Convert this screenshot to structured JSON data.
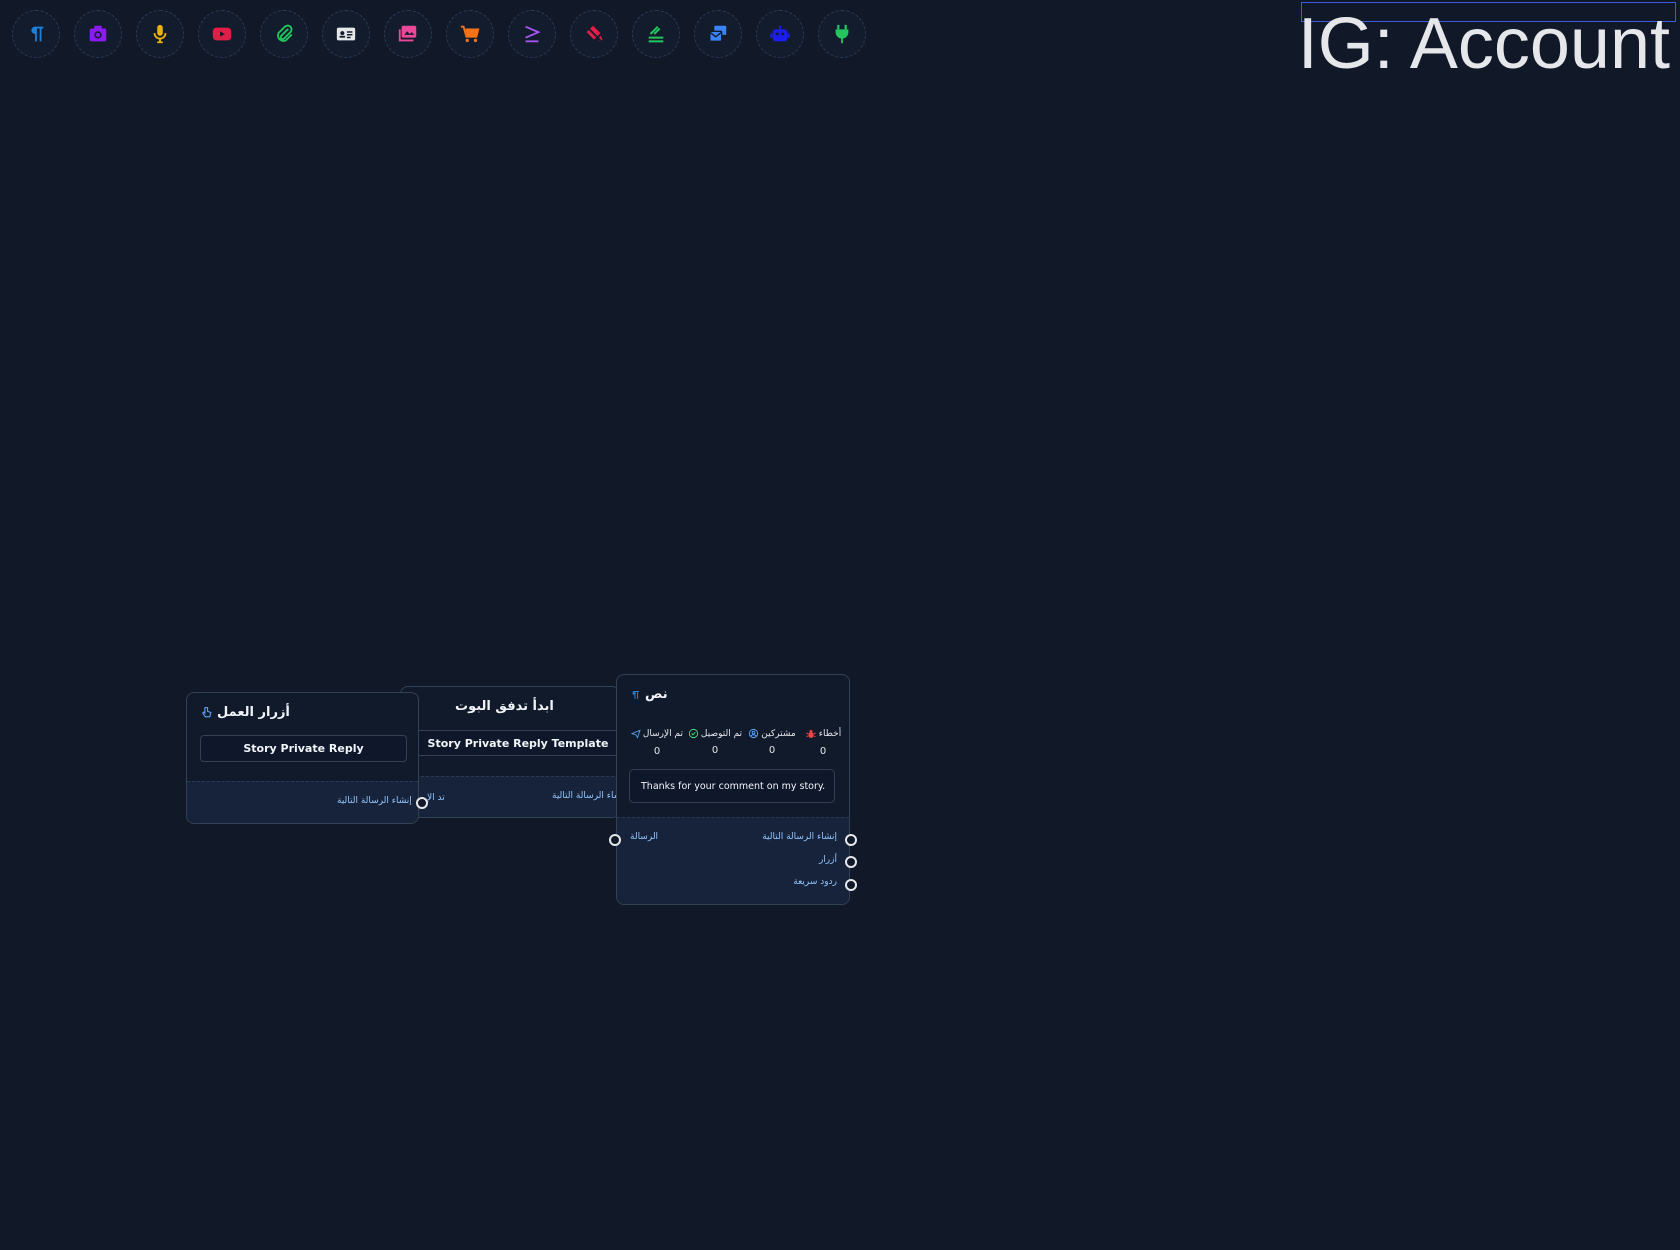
{
  "toolbar": {
    "tools": [
      {
        "name": "text-tool",
        "icon": "paragraph-icon",
        "color": "#1d7fd6"
      },
      {
        "name": "image-tool",
        "icon": "camera-icon",
        "color": "#8b1cf0"
      },
      {
        "name": "audio-tool",
        "icon": "microphone-icon",
        "color": "#eab308"
      },
      {
        "name": "video-tool",
        "icon": "youtube-icon",
        "color": "#e11d48"
      },
      {
        "name": "file-tool",
        "icon": "paperclip-icon",
        "color": "#22c55e"
      },
      {
        "name": "card-tool",
        "icon": "id-card-icon",
        "color": "#e5e7eb"
      },
      {
        "name": "gallery-tool",
        "icon": "images-icon",
        "color": "#ec4899"
      },
      {
        "name": "ecommerce-tool",
        "icon": "cart-icon",
        "color": "#f97316"
      },
      {
        "name": "condition-tool",
        "icon": "greater-equal-icon",
        "color": "#a855f7"
      },
      {
        "name": "action-tool",
        "icon": "fill-bucket-icon",
        "color": "#e11d48"
      },
      {
        "name": "sequence-tool",
        "icon": "stack-icon",
        "color": "#22c55e"
      },
      {
        "name": "messages-tool",
        "icon": "mail-bulk-icon",
        "color": "#3b82f6"
      },
      {
        "name": "bot-tool",
        "icon": "robot-icon",
        "color": "#1d1df0"
      },
      {
        "name": "plugin-tool",
        "icon": "plug-icon",
        "color": "#22c55e"
      }
    ]
  },
  "header": {
    "title": "IG: Account"
  },
  "nodes": {
    "action_buttons": {
      "title": "أزرار العمل",
      "button": "Story Private Reply",
      "port_label": "إنشاء الرسالة التالية"
    },
    "start_flow": {
      "title": "ابدأ تدفق البوت",
      "button": "Story Private Reply Template",
      "left_label": "تد الإ",
      "port_label": "إنشاء الرسالة التالية"
    },
    "text_node": {
      "title": "نص",
      "stats": [
        {
          "label": "أخطاء",
          "icon": "bug-icon",
          "value": "0"
        },
        {
          "label": "مشتركين",
          "icon": "user-circle-icon",
          "value": "0"
        },
        {
          "label": "تم التوصيل",
          "icon": "check-circle-icon",
          "value": "0"
        },
        {
          "label": "تم الإرسال",
          "icon": "paper-plane-icon",
          "value": "0"
        }
      ],
      "message": "Thanks for your comment on my story.",
      "input_label": "الرسالة",
      "outputs": [
        "إنشاء الرسالة التالية",
        "أزرار",
        "ردود سريعة"
      ]
    }
  }
}
